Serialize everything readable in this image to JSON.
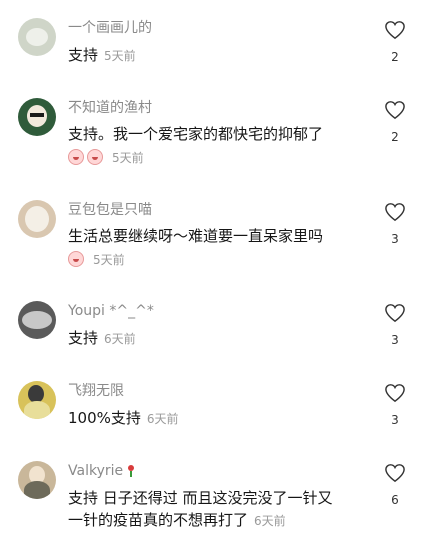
{
  "comments": [
    {
      "username": "一个画画儿的",
      "text": "支持",
      "time": "5天前",
      "likes": "2",
      "avatar_color": "#cfd5c8"
    },
    {
      "username": "不知道的渔村",
      "text": "支持。我一个爱宅家的都快宅的抑郁了",
      "time": "5天前",
      "likes": "2",
      "avatar_color": "#2f5b3a",
      "emojis": 2
    },
    {
      "username": "豆包包是只喵",
      "text": "生活总要继续呀～难道要一直呆家里吗",
      "time": "5天前",
      "likes": "3",
      "avatar_color": "#d9c7b0",
      "emojis": 1
    },
    {
      "username": "Youpi *^_^*",
      "text": "支持",
      "time": "6天前",
      "likes": "3",
      "avatar_color": "#5a5a5a"
    },
    {
      "username": "飞翔无限",
      "text": "100%支持",
      "time": "6天前",
      "likes": "3",
      "avatar_color": "#d8c25a"
    },
    {
      "username": "Valkyrie",
      "text_line1": "支持 日子还得过 而且这没完没了一针又",
      "text_line2": "一针的疫苗真的不想再打了",
      "time": "6天前",
      "likes": "6",
      "avatar_color": "#c9b79a"
    }
  ],
  "icons": {
    "like": "heart-outline-icon",
    "reaction": "face-emoji-icon",
    "name_decoration": "flower-icon"
  }
}
